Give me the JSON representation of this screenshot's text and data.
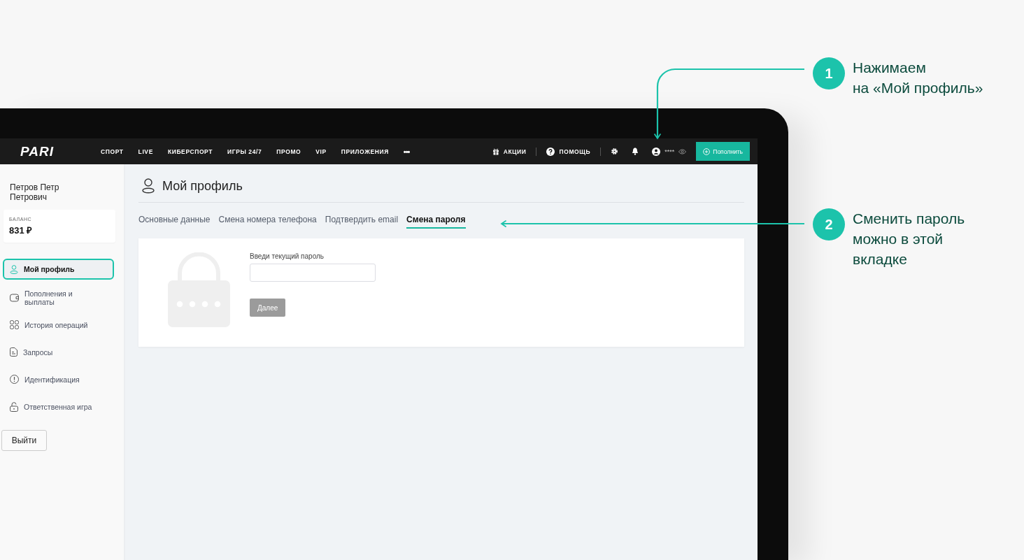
{
  "callouts": [
    {
      "number": "1",
      "lines": [
        "Нажимаем",
        "на «Мой профиль»"
      ]
    },
    {
      "number": "2",
      "lines": [
        "Сменить пароль",
        "можно в этой",
        "вкладке"
      ]
    }
  ],
  "nav": {
    "logo": "PARI",
    "items": [
      "СПОРТ",
      "LIVE",
      "КИБЕРСПОРТ",
      "ИГРЫ 24/7",
      "ПРОМО",
      "VIP",
      "ПРИЛОЖЕНИЯ"
    ],
    "more": "•••",
    "promo": "АКЦИИ",
    "help": "ПОМОЩЬ",
    "balance_mask": "****",
    "deposit": "Пополнить"
  },
  "sidebar": {
    "user_name": "Петров Петр Петрович",
    "balance_label": "БАЛАНС",
    "balance": "831 ₽",
    "items": [
      {
        "label": "Мой профиль",
        "selected": true
      },
      {
        "label": "Пополнения и выплаты",
        "selected": false
      },
      {
        "label": "История операций",
        "selected": false
      },
      {
        "label": "Запросы",
        "selected": false
      },
      {
        "label": "Идентификация",
        "selected": false
      },
      {
        "label": "Ответственная игра",
        "selected": false
      }
    ],
    "logout": "Выйти"
  },
  "page": {
    "title": "Мой профиль",
    "tabs": [
      {
        "label": "Основные данные",
        "selected": false
      },
      {
        "label": "Смена номера телефона",
        "selected": false
      },
      {
        "label": "Подтвердить email",
        "selected": false
      },
      {
        "label": "Смена пароля",
        "selected": true
      }
    ],
    "form": {
      "field_label": "Введи текущий пароль",
      "submit": "Далее",
      "submit_disabled": true
    }
  }
}
